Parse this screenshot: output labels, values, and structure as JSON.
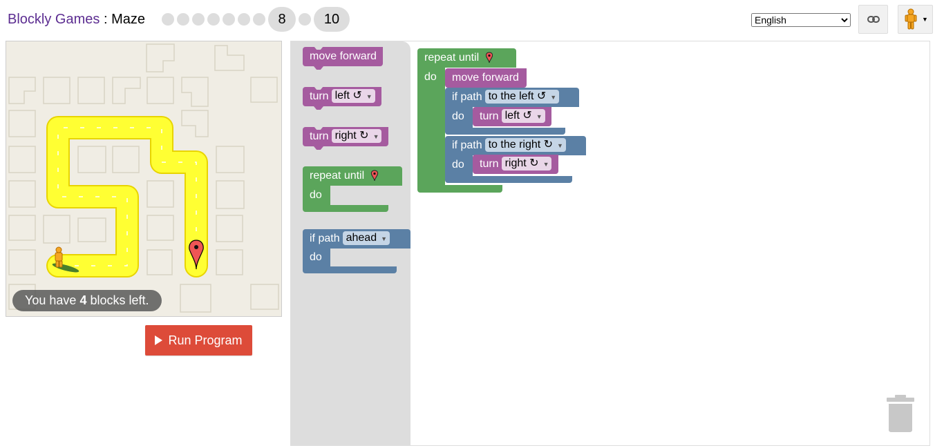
{
  "header": {
    "app_name": "Blockly Games",
    "separator": ":",
    "game_name": "Maze",
    "levels": {
      "small_dot_count": 7,
      "current_level": "8",
      "max_level": "10"
    },
    "language": "English",
    "link_icon": "link-icon",
    "pegman_icon": "pegman-icon"
  },
  "maze": {
    "capacity_prefix": "You have",
    "capacity_count": "4",
    "capacity_suffix": "blocks left.",
    "path_color": "#ffff00",
    "goal_marker_color": "#ee5555"
  },
  "run_button": {
    "label": "Run Program"
  },
  "toolbox": {
    "blocks": [
      {
        "type": "move",
        "label": "move forward"
      },
      {
        "type": "turn",
        "label": "turn",
        "field": "left ↺"
      },
      {
        "type": "turn",
        "label": "turn",
        "field": "right ↻"
      },
      {
        "type": "repeat",
        "label": "repeat until",
        "do": "do"
      },
      {
        "type": "if",
        "label": "if path",
        "field": "ahead",
        "do": "do"
      }
    ]
  },
  "workspace": {
    "repeat": {
      "label": "repeat until",
      "do": "do"
    },
    "move": {
      "label": "move forward"
    },
    "if_left": {
      "label": "if path",
      "field": "to the left ↺",
      "do": "do"
    },
    "turn_left": {
      "label": "turn",
      "field": "left ↺"
    },
    "if_right": {
      "label": "if path",
      "field": "to the right ↻",
      "do": "do"
    },
    "turn_right": {
      "label": "turn",
      "field": "right ↻"
    }
  },
  "colors": {
    "motion": "#a55b9f",
    "loop": "#5ba55b",
    "logic": "#5b80a5",
    "run_button": "#dd4b39"
  }
}
